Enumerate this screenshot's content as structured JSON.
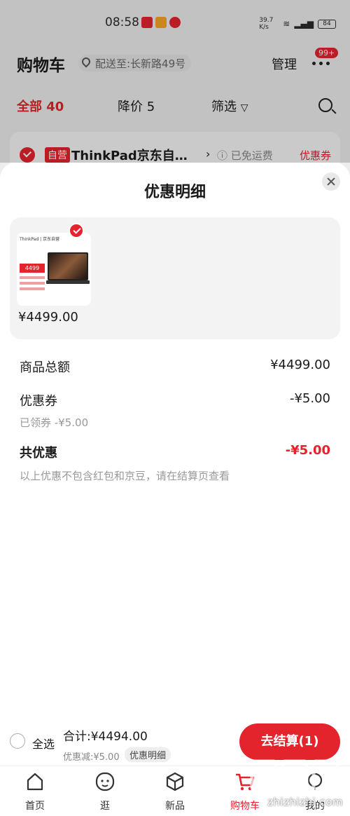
{
  "status_bar": {
    "time": "08:58",
    "net_speed": "39.7 K/s",
    "battery": "84"
  },
  "cart_header": {
    "title": "购物车",
    "address": "配送至:长新路49号",
    "manage": "管理",
    "message_badge": "99+"
  },
  "tabs": [
    {
      "label": "全部 40"
    },
    {
      "label": "降价 5"
    },
    {
      "label": "筛选"
    }
  ],
  "shop": {
    "tag": "自营",
    "name": "ThinkPad京东自…",
    "arrow": "›",
    "shipping": "已免运费",
    "coupon": "优惠券"
  },
  "sheet": {
    "title": "优惠明细",
    "product": {
      "thumb_brand": "ThinkPad | 京东自营",
      "thumb_price": "4499",
      "price": "¥4499.00"
    },
    "rows": {
      "subtotal": {
        "label": "商品总额",
        "value": "¥4499.00"
      },
      "coupon": {
        "label": "优惠券",
        "value": "-¥5.00",
        "sub": "已领券 -¥5.00"
      },
      "total_discount": {
        "label": "共优惠",
        "value": "-¥5.00",
        "note": "以上优惠不包含红包和京豆，请在结算页查看"
      }
    }
  },
  "checkout": {
    "select_all": "全选",
    "total": "合计:¥4494.00",
    "discount": "优惠减:¥5.00",
    "detail": "优惠明细",
    "pay": "去结算(1)"
  },
  "tabbar": [
    {
      "label": "首页",
      "icon": "home-icon"
    },
    {
      "label": "逛",
      "icon": "face-icon"
    },
    {
      "label": "新品",
      "icon": "cube-icon"
    },
    {
      "label": "购物车",
      "icon": "cart-icon"
    },
    {
      "label": "我的",
      "icon": "user-icon"
    }
  ],
  "watermark": "zhizhizhi.com",
  "colors": {
    "accent": "#e4242d",
    "sheet_bg": "#ffffff",
    "muted": "#999999"
  }
}
